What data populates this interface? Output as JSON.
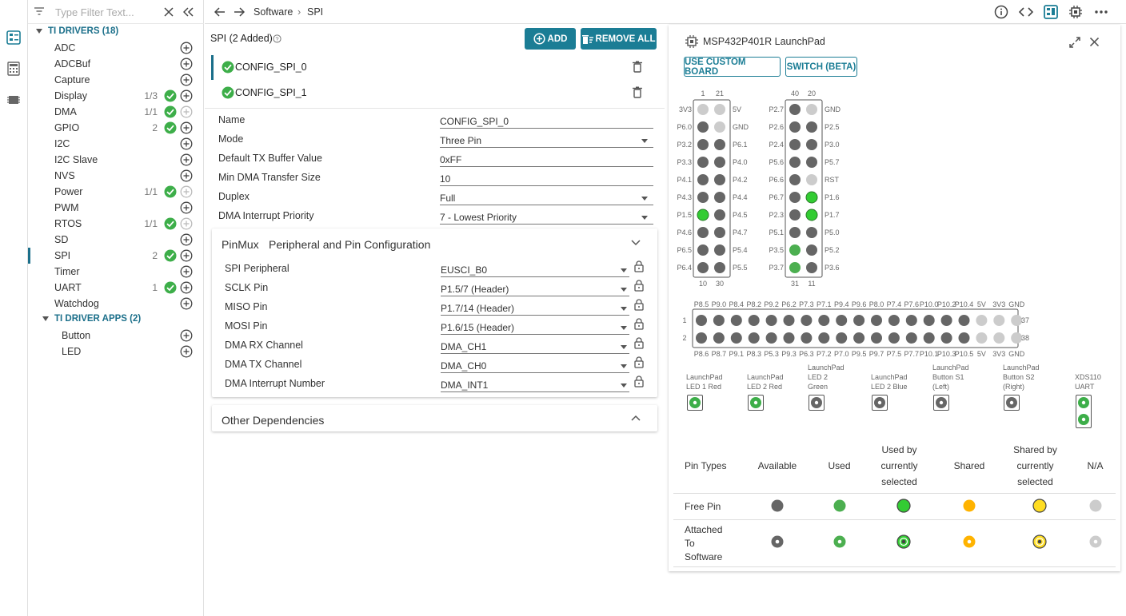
{
  "activity": {
    "items": [
      "outline-icon",
      "calculator-icon",
      "chip-icon"
    ]
  },
  "filter": {
    "placeholder": "Type Filter Text..."
  },
  "tree": {
    "drivers_title": "TI DRIVERS (18)",
    "drivers": [
      {
        "label": "ADC",
        "count": "",
        "added": false
      },
      {
        "label": "ADCBuf",
        "count": "",
        "added": false
      },
      {
        "label": "Capture",
        "count": "",
        "added": false
      },
      {
        "label": "Display",
        "count": "1/3",
        "added": true
      },
      {
        "label": "DMA",
        "count": "1/1",
        "added": true
      },
      {
        "label": "GPIO",
        "count": "2",
        "added": true
      },
      {
        "label": "I2C",
        "count": "",
        "added": false
      },
      {
        "label": "I2C Slave",
        "count": "",
        "added": false
      },
      {
        "label": "NVS",
        "count": "",
        "added": false
      },
      {
        "label": "Power",
        "count": "1/1",
        "added": true
      },
      {
        "label": "PWM",
        "count": "",
        "added": false
      },
      {
        "label": "RTOS",
        "count": "1/1",
        "added": true
      },
      {
        "label": "SD",
        "count": "",
        "added": false
      },
      {
        "label": "SPI",
        "count": "2",
        "added": true
      },
      {
        "label": "Timer",
        "count": "",
        "added": false
      },
      {
        "label": "UART",
        "count": "1",
        "added": true
      },
      {
        "label": "Watchdog",
        "count": "",
        "added": false
      }
    ],
    "apps_title": "TI DRIVER APPS (2)",
    "apps": [
      {
        "label": "Button"
      },
      {
        "label": "LED"
      }
    ]
  },
  "header": {
    "crumb1": "Software",
    "crumb_sep": "›",
    "crumb2": "SPI"
  },
  "config": {
    "title": "SPI (2 Added)",
    "add_label": "ADD",
    "remove_all_label": "REMOVE ALL",
    "instances": [
      "CONFIG_SPI_0",
      "CONFIG_SPI_1"
    ],
    "fields": [
      {
        "label": "Name",
        "value": "CONFIG_SPI_0",
        "dropdown": false
      },
      {
        "label": "Mode",
        "value": "Three Pin",
        "dropdown": true
      },
      {
        "label": "Default TX Buffer Value",
        "value": "0xFF",
        "dropdown": false
      },
      {
        "label": "Min DMA Transfer Size",
        "value": "10",
        "dropdown": false
      },
      {
        "label": "Duplex",
        "value": "Full",
        "dropdown": true
      },
      {
        "label": "DMA Interrupt Priority",
        "value": "7 - Lowest Priority",
        "dropdown": true
      }
    ],
    "pinmux_title": "PinMux",
    "pinmux_subtitle": "Peripheral and Pin Configuration",
    "pinmux": [
      {
        "label": "SPI Peripheral",
        "value": "EUSCI_B0"
      },
      {
        "label": "SCLK Pin",
        "value": "P1.5/7 (Header)"
      },
      {
        "label": "MISO Pin",
        "value": "P1.7/14 (Header)"
      },
      {
        "label": "MOSI Pin",
        "value": "P1.6/15 (Header)"
      },
      {
        "label": "DMA RX Channel",
        "value": "DMA_CH1"
      },
      {
        "label": "DMA TX Channel",
        "value": "DMA_CH0"
      },
      {
        "label": "DMA Interrupt Number",
        "value": "DMA_INT1"
      }
    ],
    "other_deps": "Other Dependencies"
  },
  "board": {
    "title": "MSP432P401R LaunchPad",
    "custom_btn": "USE CUSTOM BOARD",
    "switch_btn": "SWITCH (BETA)",
    "colors": {
      "available": "#666666",
      "used": "#4caf50",
      "selected": "#33cc33",
      "shared": "#ffb300",
      "shared_sel": "#ffdd22",
      "na": "#cccccc"
    },
    "header_left": {
      "top_nums": [
        "1",
        "21"
      ],
      "bottom_nums": [
        "10",
        "30"
      ],
      "left_labels": [
        "3V3",
        "P6.0",
        "P3.2",
        "P3.3",
        "P4.1",
        "P4.3",
        "P1.5",
        "P4.6",
        "P6.5",
        "P6.4"
      ],
      "right_labels": [
        "5V",
        "GND",
        "P6.1",
        "P4.0",
        "P4.2",
        "P4.4",
        "P4.5",
        "P4.7",
        "P5.4",
        "P5.5"
      ],
      "col_a": [
        "na",
        "avail",
        "avail",
        "avail",
        "avail",
        "avail",
        "sel",
        "avail",
        "avail",
        "avail"
      ],
      "col_b": [
        "na",
        "na",
        "avail",
        "avail",
        "avail",
        "avail",
        "avail",
        "avail",
        "avail",
        "avail"
      ]
    },
    "header_right": {
      "top_nums": [
        "40",
        "20"
      ],
      "bottom_nums": [
        "31",
        "11"
      ],
      "left_labels": [
        "P2.7",
        "P2.6",
        "P2.4",
        "P5.6",
        "P6.6",
        "P6.7",
        "P2.3",
        "P5.1",
        "P3.5",
        "P3.7"
      ],
      "right_labels": [
        "GND",
        "P2.5",
        "P3.0",
        "P5.7",
        "RST",
        "P1.6",
        "P1.7",
        "P5.0",
        "P5.2",
        "P3.6"
      ],
      "col_a": [
        "avail",
        "avail",
        "avail",
        "avail",
        "avail",
        "avail",
        "avail",
        "avail",
        "used",
        "used"
      ],
      "col_b": [
        "na",
        "avail",
        "avail",
        "avail",
        "na",
        "sel",
        "sel",
        "avail",
        "avail",
        "avail"
      ]
    },
    "bottom_header": {
      "top_labels": [
        "P8.5",
        "P9.0",
        "P8.4",
        "P8.2",
        "P9.2",
        "P6.2",
        "P7.3",
        "P7.1",
        "P9.4",
        "P9.6",
        "P8.0",
        "P7.4",
        "P7.6",
        "P10.0",
        "P10.2",
        "P10.4",
        "5V",
        "3V3",
        "GND"
      ],
      "bottom_labels": [
        "P8.6",
        "P8.7",
        "P9.1",
        "P8.3",
        "P5.3",
        "P9.3",
        "P6.3",
        "P7.2",
        "P7.0",
        "P9.5",
        "P9.7",
        "P7.5",
        "P7.7",
        "P10.1",
        "P10.3",
        "P10.5",
        "5V",
        "3V3",
        "GND"
      ],
      "row_left": [
        "1",
        "2"
      ],
      "row_right": [
        "37",
        "38"
      ]
    },
    "leds": [
      {
        "label": "LaunchPad LED 1 Red",
        "lines": [
          "LaunchPad",
          "LED 1 Red"
        ]
      },
      {
        "label": "LaunchPad LED 2 Red",
        "lines": [
          "LaunchPad",
          "LED 2 Red"
        ]
      },
      {
        "label": "LaunchPad LED 2 Green",
        "lines": [
          "LaunchPad",
          "LED 2",
          "Green"
        ]
      },
      {
        "label": "LaunchPad LED 2 Blue",
        "lines": [
          "LaunchPad",
          "LED 2 Blue"
        ]
      },
      {
        "label": "LaunchPad Button S1 (Left)",
        "lines": [
          "LaunchPad",
          "Button S1",
          "(Left)"
        ]
      },
      {
        "label": "LaunchPad Button S2 (Right)",
        "lines": [
          "LaunchPad",
          "Button S2",
          "(Right)"
        ]
      },
      {
        "label": "XDS110 UART",
        "lines": [
          "XDS110",
          "UART"
        ]
      }
    ],
    "legend": {
      "headers": [
        "Pin Types",
        "Available",
        "Used",
        "Used by currently selected",
        "Shared",
        "Shared by currently selected",
        "N/A"
      ],
      "row1": "Free Pin",
      "row2": "Attached To Software"
    }
  }
}
